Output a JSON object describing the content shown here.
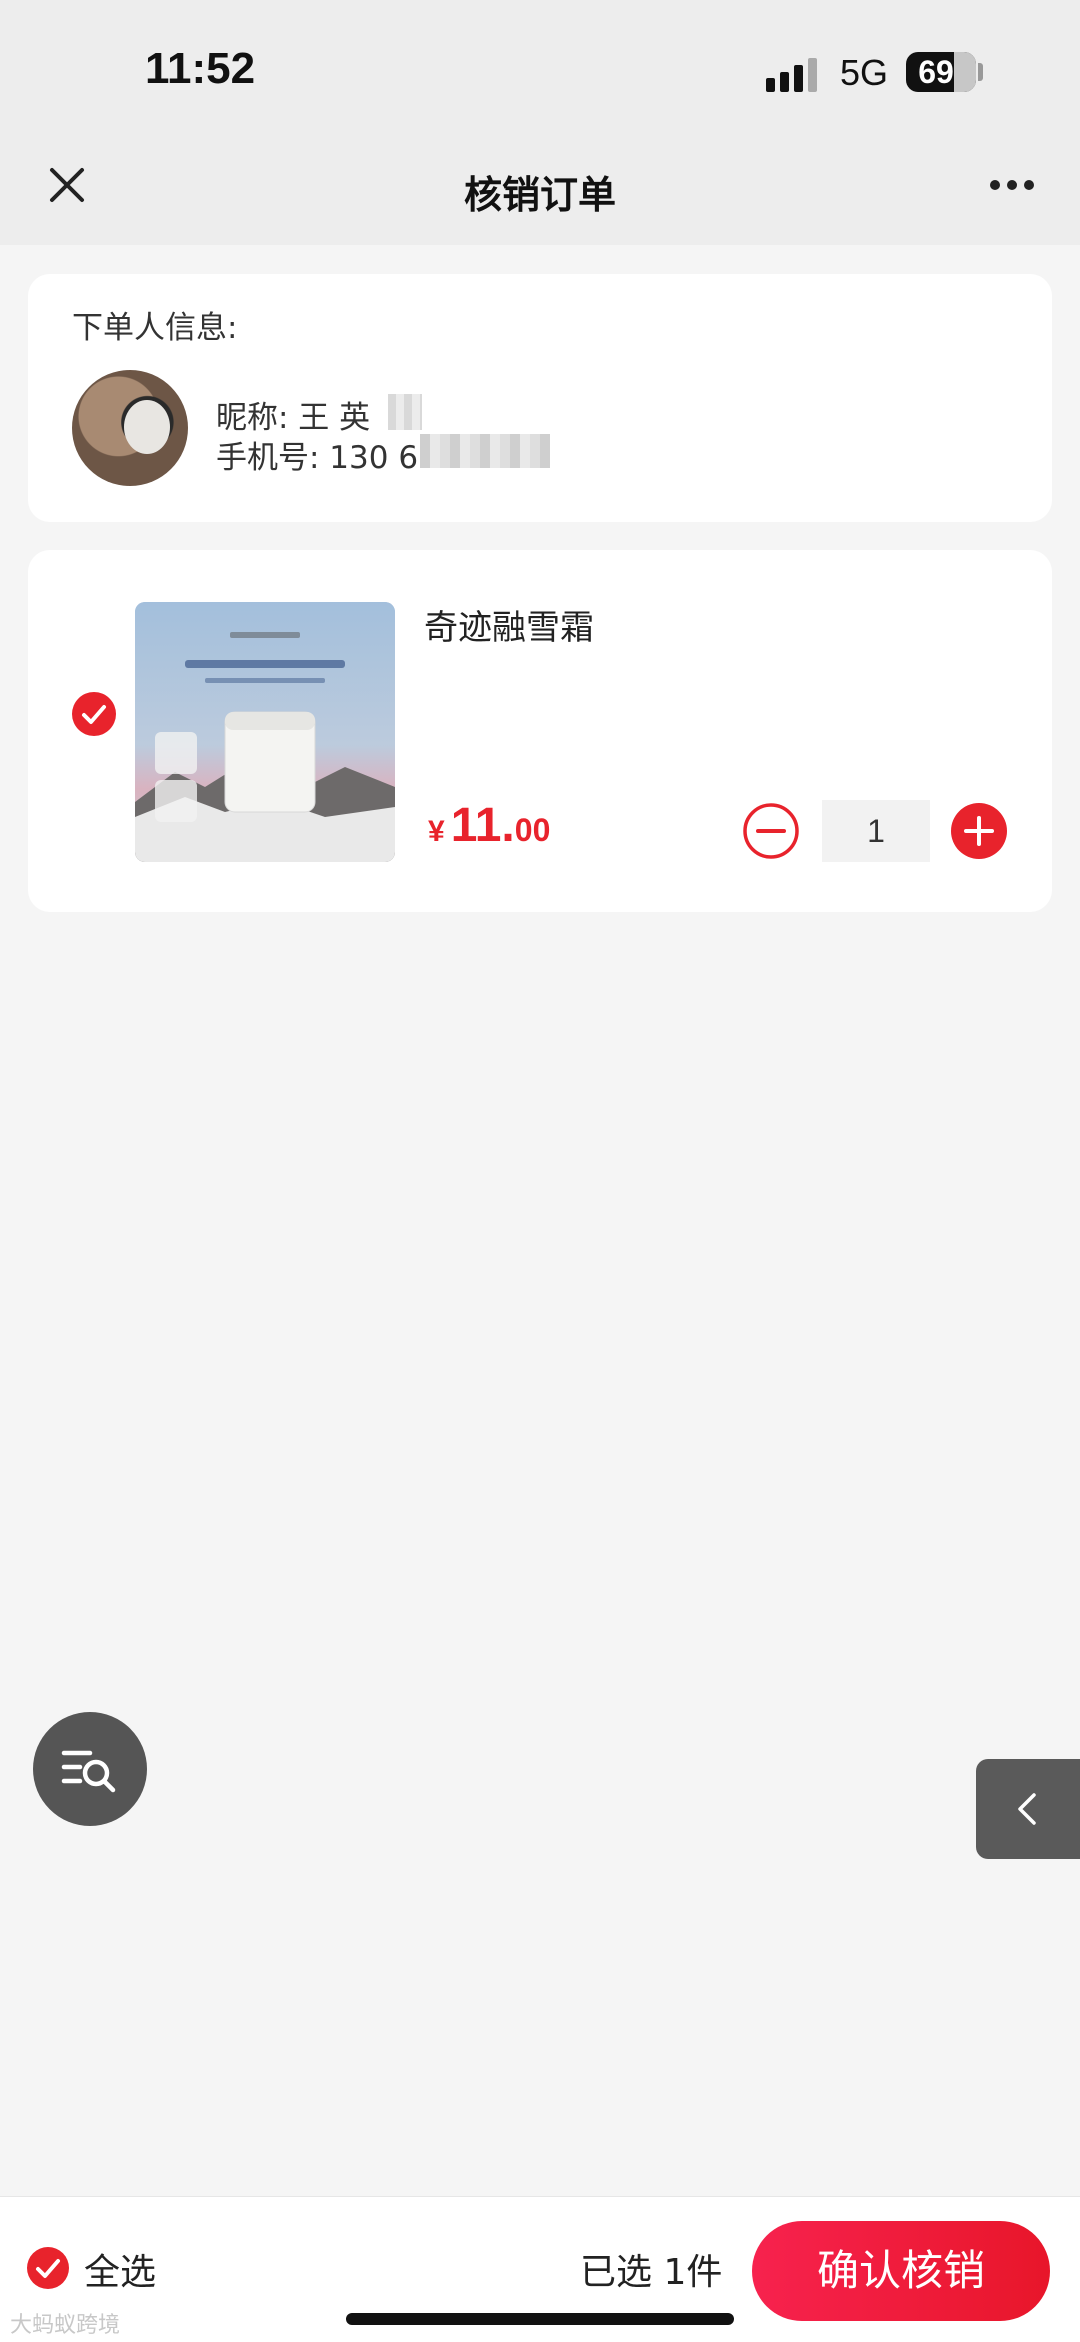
{
  "status_bar": {
    "time": "11:52",
    "network": "5G",
    "battery": "69"
  },
  "nav": {
    "title": "核销订单",
    "close_icon": "close-icon",
    "more_icon": "more-icon"
  },
  "buyer": {
    "heading": "下单人信息:",
    "nickname_text": "昵称: 王 英",
    "phone_text": "手机号: 130          6"
  },
  "product": {
    "name": "奇迹融雪霜",
    "price_symbol": "¥",
    "price_int": "11.",
    "price_dec": "00",
    "quantity": "1",
    "checked": true
  },
  "bottom": {
    "select_all_label": "全选",
    "selected_text": "已选 1件",
    "confirm_label": "确认核销",
    "watermark": "大蚂蚁跨境"
  },
  "colors": {
    "accent": "#e8232c",
    "background": "#f5f5f5",
    "nav_background": "#ededed"
  }
}
